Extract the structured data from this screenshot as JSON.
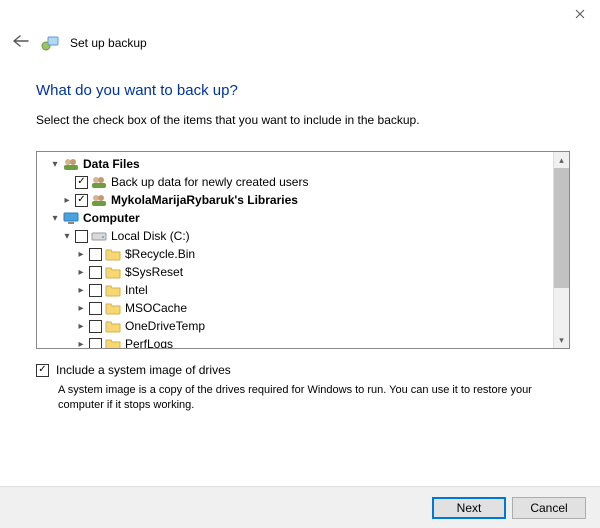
{
  "window": {
    "title": "Set up backup"
  },
  "heading": "What do you want to back up?",
  "instruction": "Select the check box of the items that you want to include in the backup.",
  "tree": {
    "root1": {
      "label": "Data Files"
    },
    "newUsers": {
      "label": "Back up data for newly created users"
    },
    "userLib": {
      "label": "MykolaMarijaRybaruk's Libraries"
    },
    "root2": {
      "label": "Computer"
    },
    "disk": {
      "label": "Local Disk (C:)"
    },
    "folders": [
      {
        "label": "$Recycle.Bin"
      },
      {
        "label": "$SysReset"
      },
      {
        "label": "Intel"
      },
      {
        "label": "MSOCache"
      },
      {
        "label": "OneDriveTemp"
      },
      {
        "label": "PerfLogs"
      }
    ]
  },
  "systemImage": {
    "label": "Include a system image of drives",
    "desc": "A system image is a copy of the drives required for Windows to run. You can use it to restore your computer if it stops working."
  },
  "buttons": {
    "next": "Next",
    "cancel": "Cancel"
  }
}
